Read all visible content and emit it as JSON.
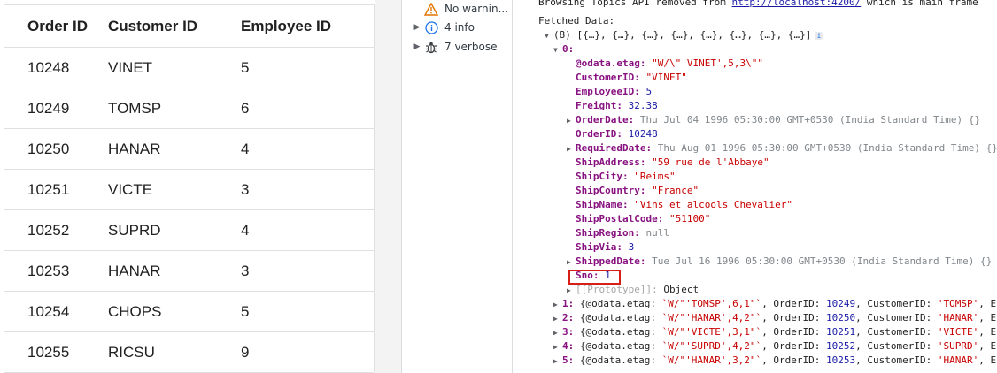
{
  "grid": {
    "headers": [
      "Order ID",
      "Customer ID",
      "Employee ID"
    ],
    "rows": [
      {
        "order_id": "10248",
        "customer_id": "VINET",
        "employee_id": "5"
      },
      {
        "order_id": "10249",
        "customer_id": "TOMSP",
        "employee_id": "6"
      },
      {
        "order_id": "10250",
        "customer_id": "HANAR",
        "employee_id": "4"
      },
      {
        "order_id": "10251",
        "customer_id": "VICTE",
        "employee_id": "3"
      },
      {
        "order_id": "10252",
        "customer_id": "SUPRD",
        "employee_id": "4"
      },
      {
        "order_id": "10253",
        "customer_id": "HANAR",
        "employee_id": "3"
      },
      {
        "order_id": "10254",
        "customer_id": "CHOPS",
        "employee_id": "5"
      },
      {
        "order_id": "10255",
        "customer_id": "RICSU",
        "employee_id": "9"
      }
    ]
  },
  "sidebar": {
    "warnings": "No warnin...",
    "info": "4 info",
    "verbose": "7 verbose"
  },
  "console": {
    "top_line_prefix": "Browsing Topics API removed from ",
    "top_line_link": "http://localhost:4200/",
    "top_line_suffix": " which is main frame",
    "fetched_label": "Fetched Data:",
    "array_summary": "(8) [{…}, {…}, {…}, {…}, {…}, {…}, {…}, {…}]",
    "item0_index": "0:",
    "props": [
      {
        "k": "@odata.etag",
        "v": "\"W/\\\"'VINET',5,3\\\"\"",
        "type": "str",
        "expand": false
      },
      {
        "k": "CustomerID",
        "v": "\"VINET\"",
        "type": "str",
        "expand": false
      },
      {
        "k": "EmployeeID",
        "v": "5",
        "type": "num",
        "expand": false
      },
      {
        "k": "Freight",
        "v": "32.38",
        "type": "num",
        "expand": false
      },
      {
        "k": "OrderDate",
        "v": "Thu Jul 04 1996 05:30:00 GMT+0530 (India Standard Time) {}",
        "type": "gray",
        "expand": true
      },
      {
        "k": "OrderID",
        "v": "10248",
        "type": "num",
        "expand": false
      },
      {
        "k": "RequiredDate",
        "v": "Thu Aug 01 1996 05:30:00 GMT+0530 (India Standard Time) {}",
        "type": "gray",
        "expand": true
      },
      {
        "k": "ShipAddress",
        "v": "\"59 rue de l'Abbaye\"",
        "type": "str",
        "expand": false
      },
      {
        "k": "ShipCity",
        "v": "\"Reims\"",
        "type": "str",
        "expand": false
      },
      {
        "k": "ShipCountry",
        "v": "\"France\"",
        "type": "str",
        "expand": false
      },
      {
        "k": "ShipName",
        "v": "\"Vins et alcools Chevalier\"",
        "type": "str",
        "expand": false
      },
      {
        "k": "ShipPostalCode",
        "v": "\"51100\"",
        "type": "str",
        "expand": false
      },
      {
        "k": "ShipRegion",
        "v": "null",
        "type": "gray",
        "expand": false
      },
      {
        "k": "ShipVia",
        "v": "3",
        "type": "num",
        "expand": false
      },
      {
        "k": "ShippedDate",
        "v": "Tue Jul 16 1996 05:30:00 GMT+0530 (India Standard Time) {}",
        "type": "gray",
        "expand": true
      },
      {
        "k": "Sno",
        "v": "1",
        "type": "num",
        "expand": false
      },
      {
        "k": "[[Prototype]]",
        "v": "Object",
        "type": "plain",
        "expand": true
      }
    ],
    "collapsed_items": [
      {
        "idx": "1:",
        "etag": "`W/\"'TOMSP',6,1\"`",
        "order": "10249",
        "cust": "'TOMSP'"
      },
      {
        "idx": "2:",
        "etag": "`W/\"'HANAR',4,2\"`",
        "order": "10250",
        "cust": "'HANAR'"
      },
      {
        "idx": "3:",
        "etag": "`W/\"'VICTE',3,1\"`",
        "order": "10251",
        "cust": "'VICTE'"
      },
      {
        "idx": "4:",
        "etag": "`W/\"'SUPRD',4,2\"`",
        "order": "10252",
        "cust": "'SUPRD'"
      },
      {
        "idx": "5:",
        "etag": "`W/\"'HANAR',3,2\"`",
        "order": "10253",
        "cust": "'HANAR'"
      }
    ]
  }
}
